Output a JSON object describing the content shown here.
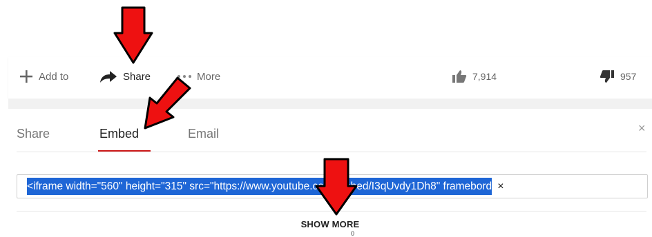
{
  "actions": {
    "add_to": "Add to",
    "share": "Share",
    "more": "More",
    "likes": "7,914",
    "dislikes": "957"
  },
  "share_panel": {
    "tabs": [
      "Share",
      "Embed",
      "Email"
    ],
    "active_tab": "Embed",
    "close": "×",
    "embed_code": "<iframe width=\"560\" height=\"315\" src=\"https://www.youtube.com/embed/I3qUvdy1Dh8\" framebord",
    "clear": "×",
    "show_more": "SHOW MORE",
    "show_more_glyph": "0"
  },
  "colors": {
    "arrow": "#ee1111",
    "selection": "#1e66d6",
    "active_underline": "#cc1818"
  },
  "icons": [
    "plus-icon",
    "share-arrow-icon",
    "more-dots-icon",
    "thumbs-up-icon",
    "thumbs-down-icon",
    "close-icon"
  ]
}
